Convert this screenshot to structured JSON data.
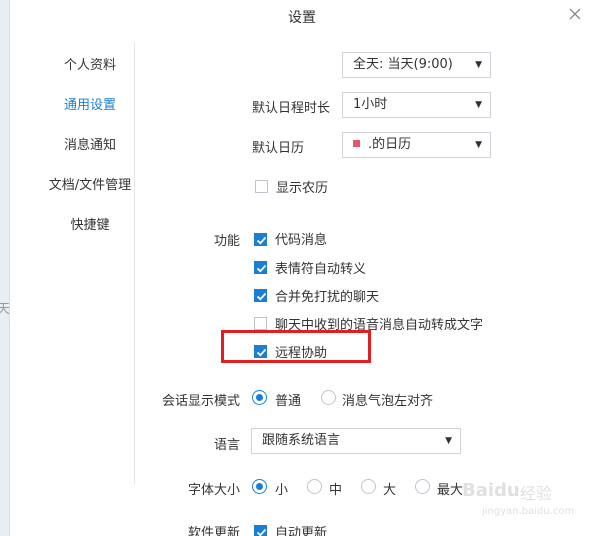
{
  "window": {
    "title": "设置"
  },
  "background_text": "天",
  "sidebar": {
    "items": [
      {
        "label": "个人资料",
        "active": false
      },
      {
        "label": "通用设置",
        "active": true
      },
      {
        "label": "消息通知",
        "active": false
      },
      {
        "label": "文档/文件管理",
        "active": false
      },
      {
        "label": "快捷键",
        "active": false
      }
    ]
  },
  "calendar": {
    "allday_reminder": {
      "value": "全天: 当天(9:00)"
    },
    "default_duration": {
      "label": "默认日程时长",
      "value": "1小时"
    },
    "default_calendar": {
      "label": "默认日历",
      "value": ".的日历",
      "color": "#e9566b"
    },
    "lunar": {
      "label": "显示农历",
      "checked": false
    }
  },
  "features": {
    "label": "功能",
    "options": [
      {
        "label": "代码消息",
        "checked": true
      },
      {
        "label": "表情符自动转义",
        "checked": true
      },
      {
        "label": "合并免打扰的聊天",
        "checked": true
      },
      {
        "label": "聊天中收到的语音消息自动转成文字",
        "checked": false
      },
      {
        "label": "远程协助",
        "checked": true
      }
    ]
  },
  "session_mode": {
    "label": "会话显示模式",
    "options": [
      {
        "label": "普通",
        "selected": true
      },
      {
        "label": "消息气泡左对齐",
        "selected": false
      }
    ]
  },
  "language": {
    "label": "语言",
    "value": "跟随系统语言"
  },
  "font_size": {
    "label": "字体大小",
    "options": [
      {
        "label": "小",
        "selected": true
      },
      {
        "label": "中",
        "selected": false
      },
      {
        "label": "大",
        "selected": false
      },
      {
        "label": "最大",
        "selected": false
      }
    ]
  },
  "software_update": {
    "label": "软件更新",
    "option": {
      "label": "自动更新",
      "checked": true
    }
  },
  "watermark": {
    "brand": "Baidu",
    "sub": "经验",
    "url": "jingyan.baidu.com"
  },
  "colors": {
    "accent": "#1a7fd4",
    "highlight_box": "#e02020"
  }
}
